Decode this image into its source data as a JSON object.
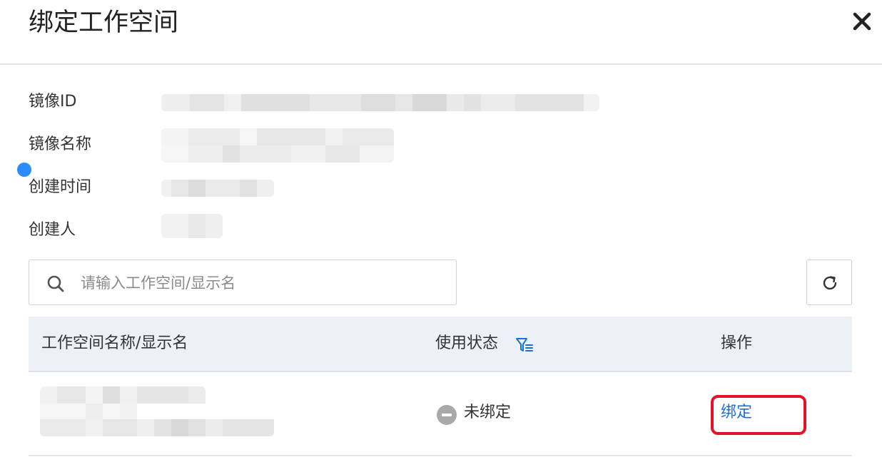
{
  "dialog": {
    "title": "绑定工作空间",
    "close_icon": "close-icon"
  },
  "info": {
    "image_id_label": "镜像ID",
    "image_name_label": "镜像名称",
    "created_time_label": "创建时间",
    "creator_label": "创建人"
  },
  "search": {
    "placeholder": "请输入工作空间/显示名",
    "value": "",
    "icon": "search-icon"
  },
  "refresh": {
    "icon": "refresh-icon"
  },
  "table": {
    "columns": [
      "工作空间名称/显示名",
      "使用状态",
      "操作"
    ],
    "filter_icon": "filter-icon",
    "rows": [
      {
        "status": "未绑定",
        "action": "绑定"
      }
    ]
  },
  "colors": {
    "accent": "#1a6fd8",
    "highlight": "#e5122b",
    "header_bg": "#ecf0f7",
    "status_unbound": "#a9a9a9",
    "indicator_dot": "#2a8cff"
  }
}
